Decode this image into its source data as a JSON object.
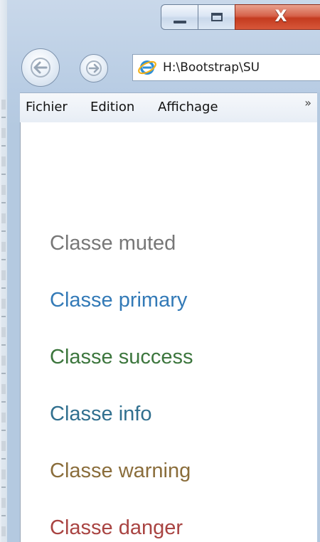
{
  "window": {
    "controls": {
      "minimize_icon": "minimize-icon",
      "maximize_icon": "maximize-icon",
      "close_label": "X"
    }
  },
  "toolbar": {
    "back_icon": "arrow-left-icon",
    "forward_icon": "arrow-right-icon",
    "address": "H:\\Bootstrap\\SU",
    "browser_icon": "ie-icon"
  },
  "menu": {
    "items": [
      "Fichier",
      "Edition",
      "Affichage"
    ],
    "overflow": "»"
  },
  "content": {
    "lines": [
      {
        "text": "Classe muted",
        "color": "#777777"
      },
      {
        "text": "Classe primary",
        "color": "#337ab7"
      },
      {
        "text": "Classe success",
        "color": "#3c763d"
      },
      {
        "text": "Classe info",
        "color": "#31708f"
      },
      {
        "text": "Classe warning",
        "color": "#8a6d3b"
      },
      {
        "text": "Classe danger",
        "color": "#a94442"
      }
    ]
  }
}
